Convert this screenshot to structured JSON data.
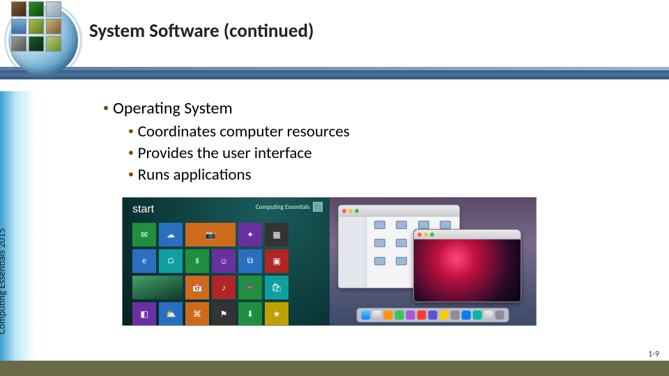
{
  "header": {
    "title": "System Software (continued)"
  },
  "sidebar": {
    "label": "Computing Essentials 2015"
  },
  "bullets": {
    "level1": "Operating System",
    "level2": [
      "Coordinates computer resources",
      "Provides the user interface",
      "Runs applications"
    ]
  },
  "screenshots": {
    "win_start_label": "start",
    "win_user_label": "Computing Essentials"
  },
  "footer": {
    "page": "1-9"
  }
}
